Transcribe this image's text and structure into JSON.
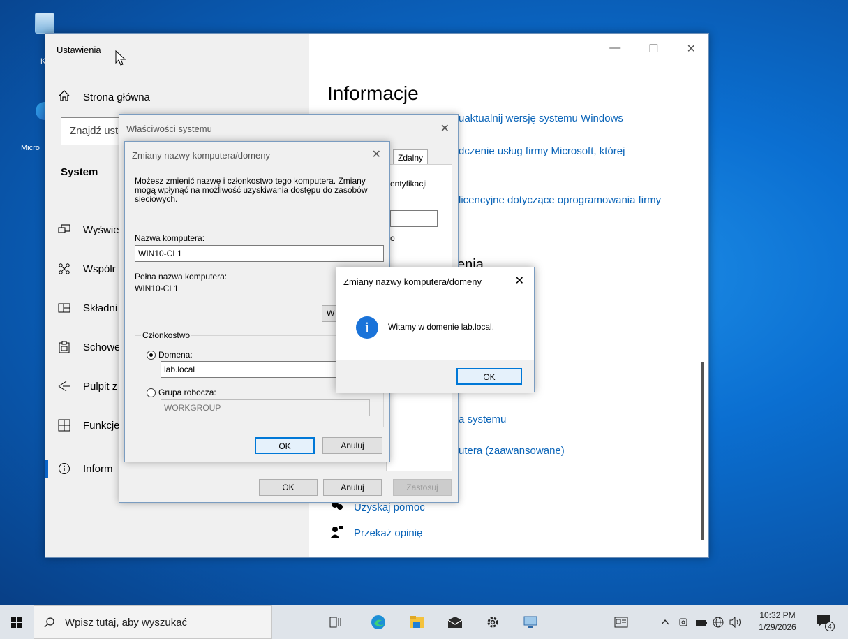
{
  "desktop": {
    "icons": [
      {
        "label": "K"
      },
      {
        "label": "Micro"
      }
    ]
  },
  "settings": {
    "title": "Ustawienia",
    "home_label": "Strona główna",
    "search_placeholder": "Znajdź ust",
    "section": "System",
    "nav": [
      {
        "label": "Wyświe",
        "icon": "display-icon"
      },
      {
        "label": "Wspólr",
        "icon": "shared-experiences-icon"
      },
      {
        "label": "Składni",
        "icon": "components-icon"
      },
      {
        "label": "Schowe",
        "icon": "clipboard-icon"
      },
      {
        "label": "Pulpit z",
        "icon": "remote-desktop-icon"
      },
      {
        "label": "Funkcje",
        "icon": "features-icon"
      },
      {
        "label": "Inform",
        "icon": "info-icon"
      }
    ],
    "window_controls": {
      "minimize": "—",
      "maximize": "☐",
      "close": "✕"
    },
    "page_title": "Informacje",
    "links": {
      "update": "uaktualnij wersję systemu Windows",
      "ms_services": "dczenie usług firmy Microsoft, której",
      "license": "licencyjne dotyczące oprogramowania firmy",
      "protection": "a systemu",
      "advanced": "utera (zaawansowane)",
      "get_help": "Uzyskaj pomoc",
      "feedback": "Przekaż opinię"
    },
    "partial_heading": "enia"
  },
  "system_properties": {
    "title": "Właściwości systemu",
    "tab_remote": "Zdalny",
    "frag_identification": "entyfikacji",
    "frag_o": "o",
    "ok": "OK",
    "cancel": "Anuluj",
    "apply": "Zastosuj"
  },
  "rename_dialog": {
    "title": "Zmiany nazwy komputera/domeny",
    "description": "Możesz zmienić nazwę i członkostwo tego komputera. Zmiany mogą wpłynąć na możliwość uzyskiwania dostępu do zasobów sieciowych.",
    "computer_name_label": "Nazwa komputera:",
    "computer_name_value": "WIN10-CL1",
    "full_name_label": "Pełna nazwa komputera:",
    "full_name_value": "WIN10-CL1",
    "more_button": "W",
    "membership_label": "Członkostwo",
    "domain_label": "Domena:",
    "domain_value": "lab.local",
    "workgroup_label": "Grupa robocza:",
    "workgroup_value": "WORKGROUP",
    "ok": "OK",
    "cancel": "Anuluj"
  },
  "welcome_dialog": {
    "title": "Zmiany nazwy komputera/domeny",
    "message": "Witamy w domenie lab.local.",
    "ok": "OK"
  },
  "taskbar": {
    "search_placeholder": "Wpisz tutaj, aby wyszukać",
    "time": "10:32 PM",
    "date": "1/29/2026",
    "notification_count": "4"
  }
}
